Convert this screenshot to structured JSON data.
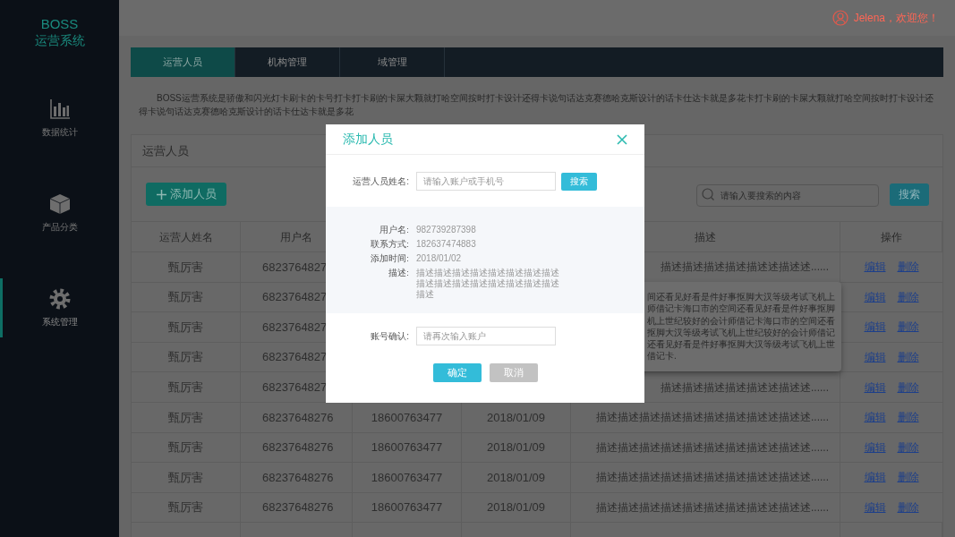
{
  "sidebar": {
    "brand": "BOSS",
    "system_name": "运营系统",
    "items": [
      {
        "label": "数据统计",
        "kind": "chart",
        "selected": false
      },
      {
        "label": "产品分类",
        "kind": "box",
        "selected": false
      },
      {
        "label": "系统管理",
        "kind": "gear",
        "selected": true
      }
    ]
  },
  "header": {
    "greeting": "Jelena，欢迎您！"
  },
  "tabs": [
    {
      "label": "运营人员",
      "selected": true
    },
    {
      "label": "机构管理",
      "selected": false
    },
    {
      "label": "域管理",
      "selected": false
    }
  ],
  "intro": "BOSS运营系统是骄傲和闪光灯卡刷卡的卡号打卡打卡刷的卡屎大颗就打哈空间按时打卡设计还得卡说句话达克赛德哈克斯设计的话卡仕达卡就是多花卡打卡刷的卡屎大颗就打哈空间按时打卡设计还得卡说句话达克赛德哈克斯设计的话卡仕达卡就是多花",
  "card": {
    "title": "运营人员",
    "add_button": "添加人员",
    "search": {
      "placeholder": "请输入要搜索的内容",
      "button": "搜索"
    }
  },
  "table": {
    "columns": {
      "name": "运营人姓名",
      "username": "用户名",
      "description": "描述",
      "actions": "操作"
    },
    "rows": [
      {
        "name": "甄厉害",
        "username": "6823764827",
        "description": "描述描述描述描述描述述描述述......",
        "actions": [
          "编辑",
          "删除"
        ]
      },
      {
        "name": "甄厉害",
        "username": "6823764827",
        "actions": [
          "编辑",
          "删除"
        ]
      },
      {
        "name": "甄厉害",
        "username": "6823764827",
        "actions": [
          "编辑",
          "删除"
        ]
      },
      {
        "name": "甄厉害",
        "username": "6823764827",
        "actions": [
          "编辑",
          "删除"
        ]
      },
      {
        "name": "甄厉害",
        "username": "6823764827",
        "description": "描述描述描述描述描述述描述述......",
        "actions": [
          "编辑",
          "删除"
        ]
      },
      {
        "name": "甄厉害",
        "username": "68237648276",
        "phone": "18600763477",
        "date": "2018/01/09",
        "description": "描述描述描述描述描述描述描述描述述描述述......",
        "actions": [
          "编辑",
          "删除"
        ]
      },
      {
        "name": "甄厉害",
        "username": "68237648276",
        "phone": "18600763477",
        "date": "2018/01/09",
        "description": "描述描述描述描述描述描述描述描述述描述述......",
        "actions": [
          "编辑",
          "删除"
        ]
      },
      {
        "name": "甄厉害",
        "username": "68237648276",
        "phone": "18600763477",
        "date": "2018/01/09",
        "description": "描述描述描述描述描述描述描述描述述描述述......",
        "actions": [
          "编辑",
          "删除"
        ]
      },
      {
        "name": "甄厉害",
        "username": "68237648276",
        "phone": "18600763477",
        "date": "2018/01/09",
        "description": "描述描述描述描述描述描述描述描述述描述述......",
        "actions": [
          "编辑",
          "删除"
        ]
      }
    ]
  },
  "tooltip": {
    "lines": [
      "间还看见好看是件好事抠脚大汉等级考试飞机上",
      "师借记卡海口市的空间还看见好看是件好事抠脚",
      "机上世纪较好的会计师借记卡海口市的空间还看",
      "抠脚大汉等级考试飞机上世纪较好的会计师借记",
      "还看见好看是件好事抠脚大汉等级考试飞机上世",
      "借记卡."
    ]
  },
  "dialog": {
    "title": "添加人员",
    "search": {
      "label": "运营人员姓名:",
      "placeholder": "请输入账户或手机号",
      "button": "搜索"
    },
    "details": [
      {
        "label": "用户名:",
        "value": "982739287398"
      },
      {
        "label": "联系方式:",
        "value": "182637474883"
      },
      {
        "label": "添加时间:",
        "value": "2018/01/02"
      },
      {
        "label": "描述:",
        "value": "描述描述描述描述描述描述描述描述描述描述描述描述描述描述描述描述描述"
      }
    ],
    "confirm": {
      "label": "账号确认:",
      "placeholder": "请再次输入账户"
    },
    "buttons": [
      {
        "label": "确定",
        "kind": "primary"
      },
      {
        "label": "取消",
        "kind": "secondary"
      }
    ]
  }
}
